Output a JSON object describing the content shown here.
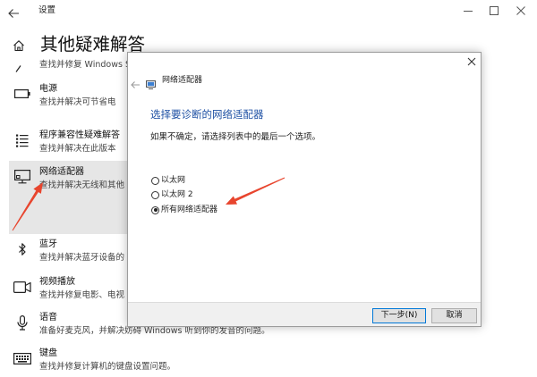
{
  "colors": {
    "accent": "#0078d7",
    "heading": "#1f51a4",
    "annotation": "#e8452e",
    "selected_bg": "#e6e6e6"
  },
  "titlebar": {
    "title": "设置",
    "back_icon": "back-arrow-icon",
    "controls": [
      "minimize-icon",
      "maximize-icon",
      "close-icon"
    ]
  },
  "page": {
    "title": "其他疑难解答",
    "home_icon": "home-icon"
  },
  "partial_item": {
    "desc": "查找并修复 Windows S"
  },
  "items": [
    {
      "title": "电源",
      "desc": "查找并解决可节省电",
      "icon": "battery-icon",
      "selected": false
    },
    {
      "title": "程序兼容性疑难解答",
      "desc": "查找并解决在此版本",
      "icon": "program-list-icon",
      "selected": false
    },
    {
      "title": "网络适配器",
      "desc": "查找并解决无线和其他",
      "icon": "network-adapter-icon",
      "selected": true
    },
    {
      "title": "蓝牙",
      "desc": "查找并解决蓝牙设备的",
      "icon": "bluetooth-icon",
      "selected": false
    },
    {
      "title": "视频播放",
      "desc": "查找并修复电影、电视",
      "icon": "video-camera-icon",
      "selected": false
    },
    {
      "title": "语音",
      "desc": "准备好麦克风，并解决妨碍 Windows 听到你的发音的问题。",
      "icon": "microphone-icon",
      "selected": false
    },
    {
      "title": "键盘",
      "desc": "查找并修复计算机的键盘设置问题。",
      "icon": "keyboard-icon",
      "selected": false
    }
  ],
  "dialog": {
    "title": "网络适配器",
    "heading": "选择要诊断的网络适配器",
    "instruction": "如果不确定，请选择列表中的最后一个选项。",
    "options": [
      {
        "label": "以太网",
        "checked": false
      },
      {
        "label": "以太网 2",
        "checked": false
      },
      {
        "label": "所有网络适配器",
        "checked": true
      }
    ],
    "next_label": "下一步(N)",
    "cancel_label": "取消"
  }
}
